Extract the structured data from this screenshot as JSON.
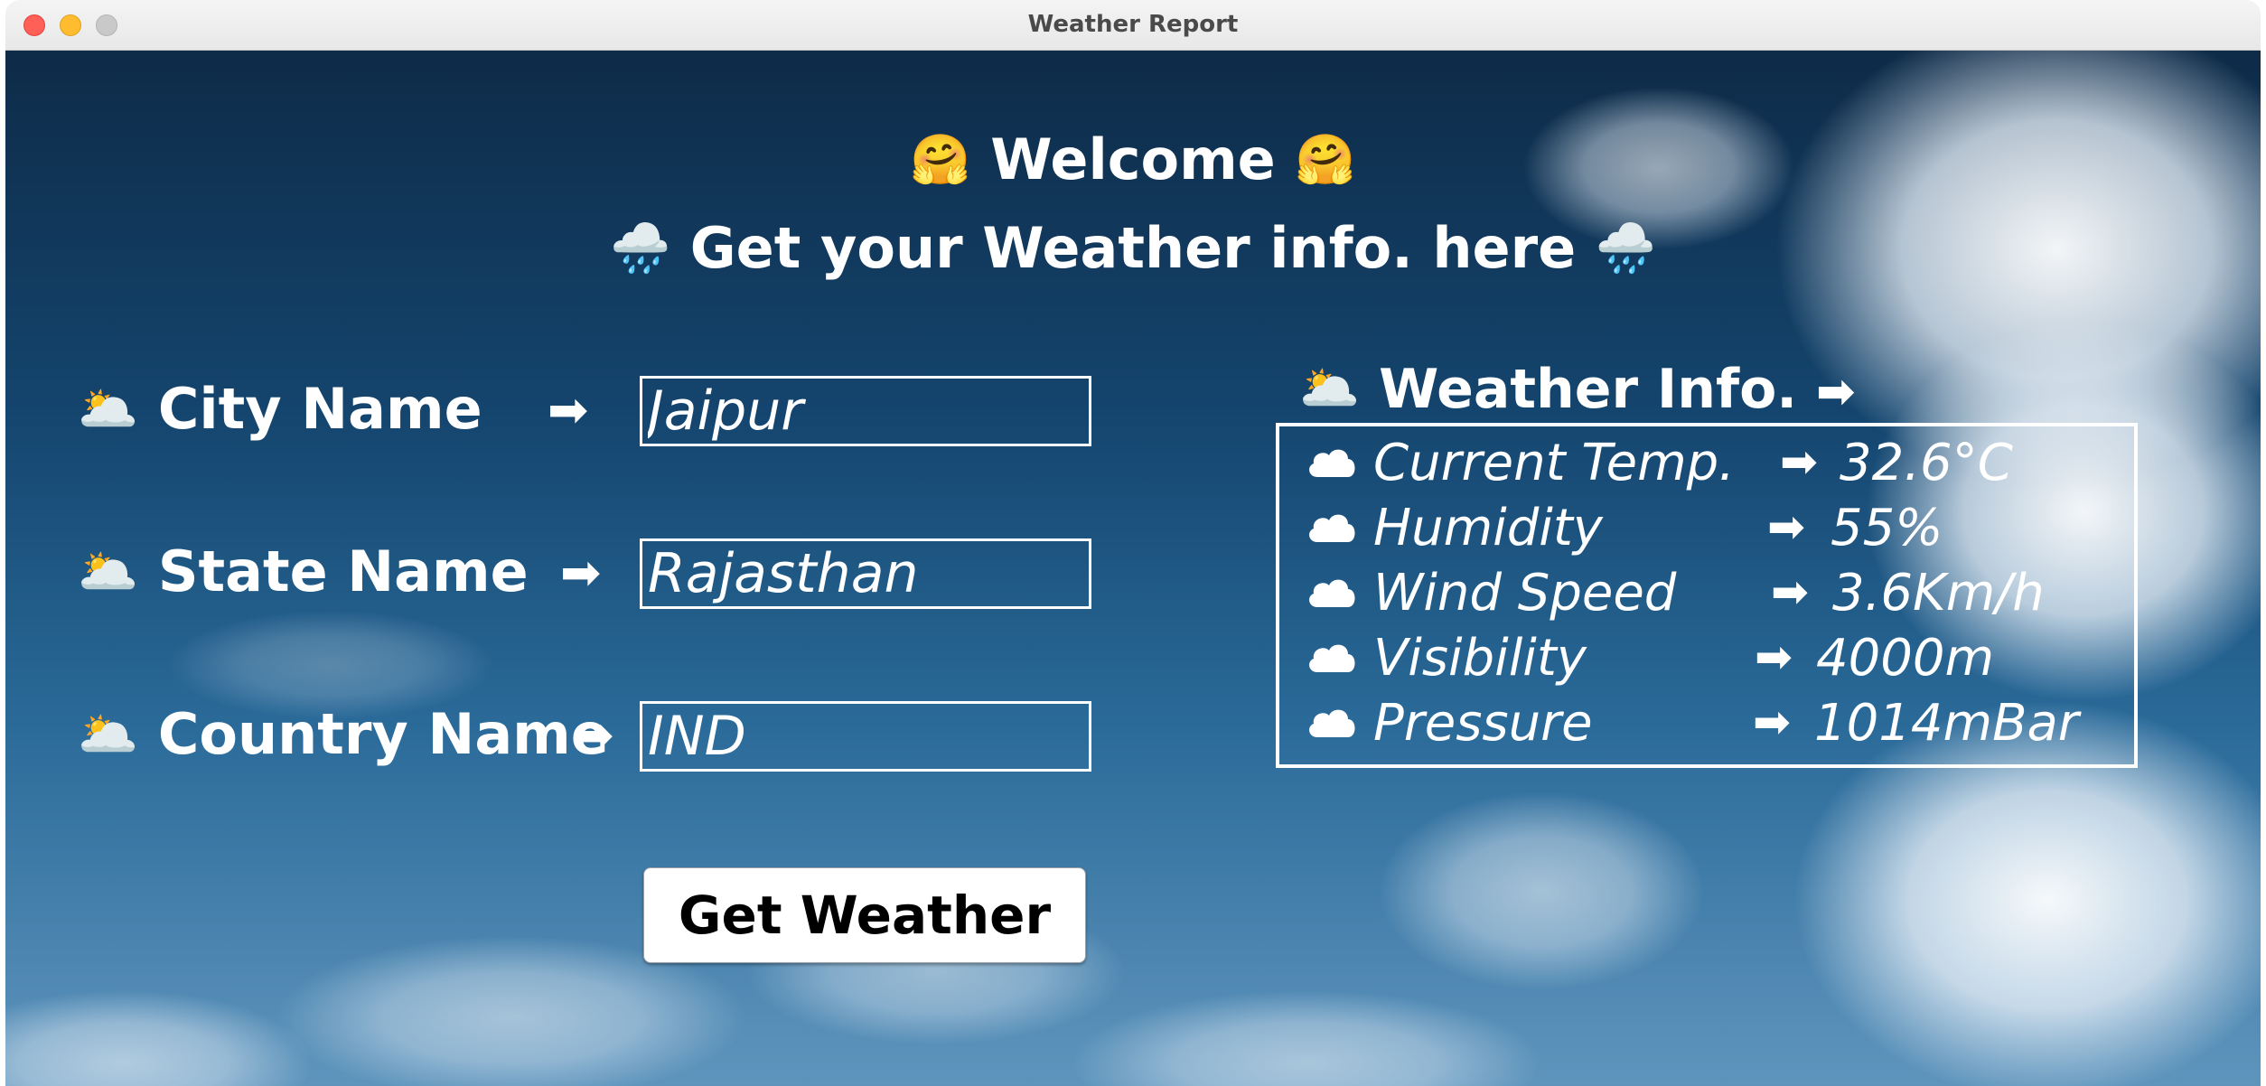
{
  "window": {
    "title": "Weather Report"
  },
  "header": {
    "welcome_emoji": "🤗",
    "welcome_text": "Welcome",
    "subtitle_emoji": "🌧️",
    "subtitle_text": "Get your Weather info. here"
  },
  "form": {
    "label_emoji": "🌥️",
    "arrow": "➡",
    "city": {
      "label": "City Name",
      "value": "Jaipur"
    },
    "state": {
      "label": "State Name",
      "value": "Rajasthan"
    },
    "country": {
      "label": "Country Name",
      "value": "IND"
    },
    "submit_label": "Get Weather"
  },
  "weather_info": {
    "title_emoji": "🌥️",
    "title": "Weather Info.",
    "arrow": "➡",
    "row_icon": "cloud-icon",
    "rows": [
      {
        "label": "Current Temp.",
        "value": "32.6°C"
      },
      {
        "label": "Humidity",
        "value": "55%"
      },
      {
        "label": "Wind Speed",
        "value": "3.6Km/h"
      },
      {
        "label": "Visibility",
        "value": "4000m"
      },
      {
        "label": "Pressure",
        "value": "1014mBar"
      }
    ]
  },
  "colors": {
    "sky_dark": "#0e2b48",
    "sky_light": "#5f95bd",
    "text": "#ffffff",
    "button_bg": "#ffffff",
    "button_text": "#000000"
  }
}
